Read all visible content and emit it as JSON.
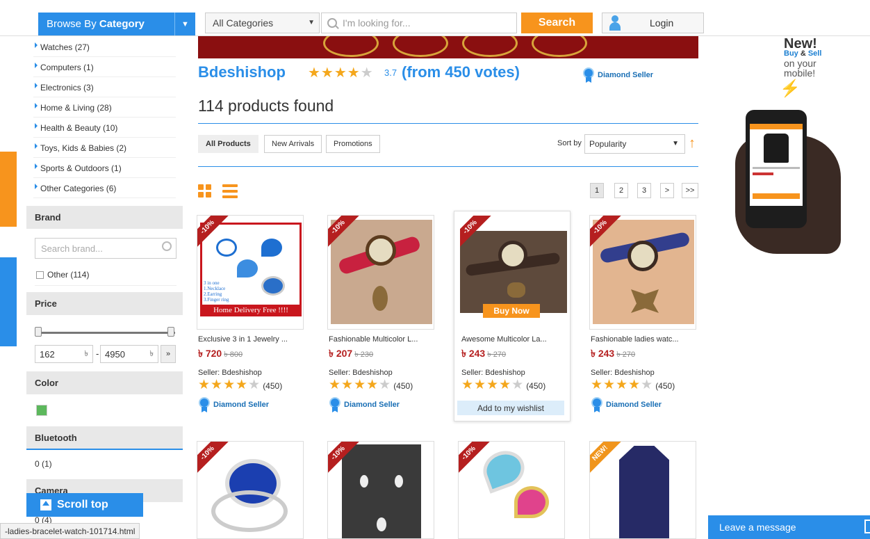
{
  "header": {
    "browse_prefix": "Browse By ",
    "browse_bold": "Category",
    "category_select": "All Categories",
    "search_placeholder": "I'm looking for...",
    "search_button": "Search",
    "login": "Login"
  },
  "sidebar": {
    "categories": [
      "Watches (27)",
      "Computers (1)",
      "Electronics (3)",
      "Home & Living (28)",
      "Health & Beauty (10)",
      "Toys, Kids & Babies (2)",
      "Sports & Outdoors (1)",
      "Other Categories (6)"
    ],
    "brand_title": "Brand",
    "brand_placeholder": "Search brand...",
    "brand_other": "Other (114)",
    "price_title": "Price",
    "price_min": "162",
    "price_max": "4950",
    "currency": "৳",
    "price_dash": "-",
    "price_go": "»",
    "color_title": "Color",
    "color_swatch": "#5cb85c",
    "bluetooth_title": "Bluetooth",
    "bluetooth_value": "0 (1)",
    "camera_title": "Camera",
    "camera_value": "0 (4)"
  },
  "shop": {
    "name": "Bdeshishop",
    "rating_stars": 3.7,
    "rating_score": "3.7",
    "votes": "(from 450 votes)",
    "badge": "Diamond Seller",
    "found": "114 products found"
  },
  "tabs": [
    "All Products",
    "New Arrivals",
    "Promotions"
  ],
  "sort": {
    "label": "Sort by",
    "value": "Popularity",
    "arrow": "↑"
  },
  "pagination": [
    "1",
    "2",
    "3",
    ">",
    ">>"
  ],
  "products": [
    {
      "ribbon": "-10%",
      "name": "Exclusive 3 in 1 Jewelry ...",
      "price": "৳ 720",
      "old": "৳ 800",
      "seller": "Seller: Bdeshishop",
      "count": "(450)",
      "badge": "Diamond Seller"
    },
    {
      "ribbon": "-10%",
      "name": "Fashionable Multicolor L...",
      "price": "৳ 207",
      "old": "৳ 230",
      "seller": "Seller: Bdeshishop",
      "count": "(450)",
      "badge": "Diamond Seller"
    },
    {
      "ribbon": "-10%",
      "name": "Awesome Multicolor La...",
      "price": "৳ 243",
      "old": "৳ 270",
      "seller": "Seller: Bdeshishop",
      "count": "(450)",
      "buy_now": "Buy Now",
      "wishlist": "Add to my wishlist"
    },
    {
      "ribbon": "-10%",
      "name": "Fashionable ladies watc...",
      "price": "৳ 243",
      "old": "৳ 270",
      "seller": "Seller: Bdeshishop",
      "count": "(450)",
      "badge": "Diamond Seller"
    },
    {
      "ribbon": "-10%"
    },
    {
      "ribbon": "-10%"
    },
    {
      "ribbon": "-10%"
    },
    {
      "ribbon": "NEW!"
    }
  ],
  "product_img_text": {
    "lines": [
      "3 in one",
      "1.Necklace",
      "2.Earring",
      "3.Finger ring"
    ],
    "delivery": "Home Delivery Free !!!!"
  },
  "ad": {
    "new": "New!",
    "buy": "Buy",
    "amp": " & ",
    "sell": "Sell",
    "line2": "on your",
    "line3": "mobile!"
  },
  "overlays": {
    "scroll_top": "Scroll top",
    "status_url": "-ladies-bracelet-watch-101714.html",
    "leave_message": "Leave a message"
  }
}
